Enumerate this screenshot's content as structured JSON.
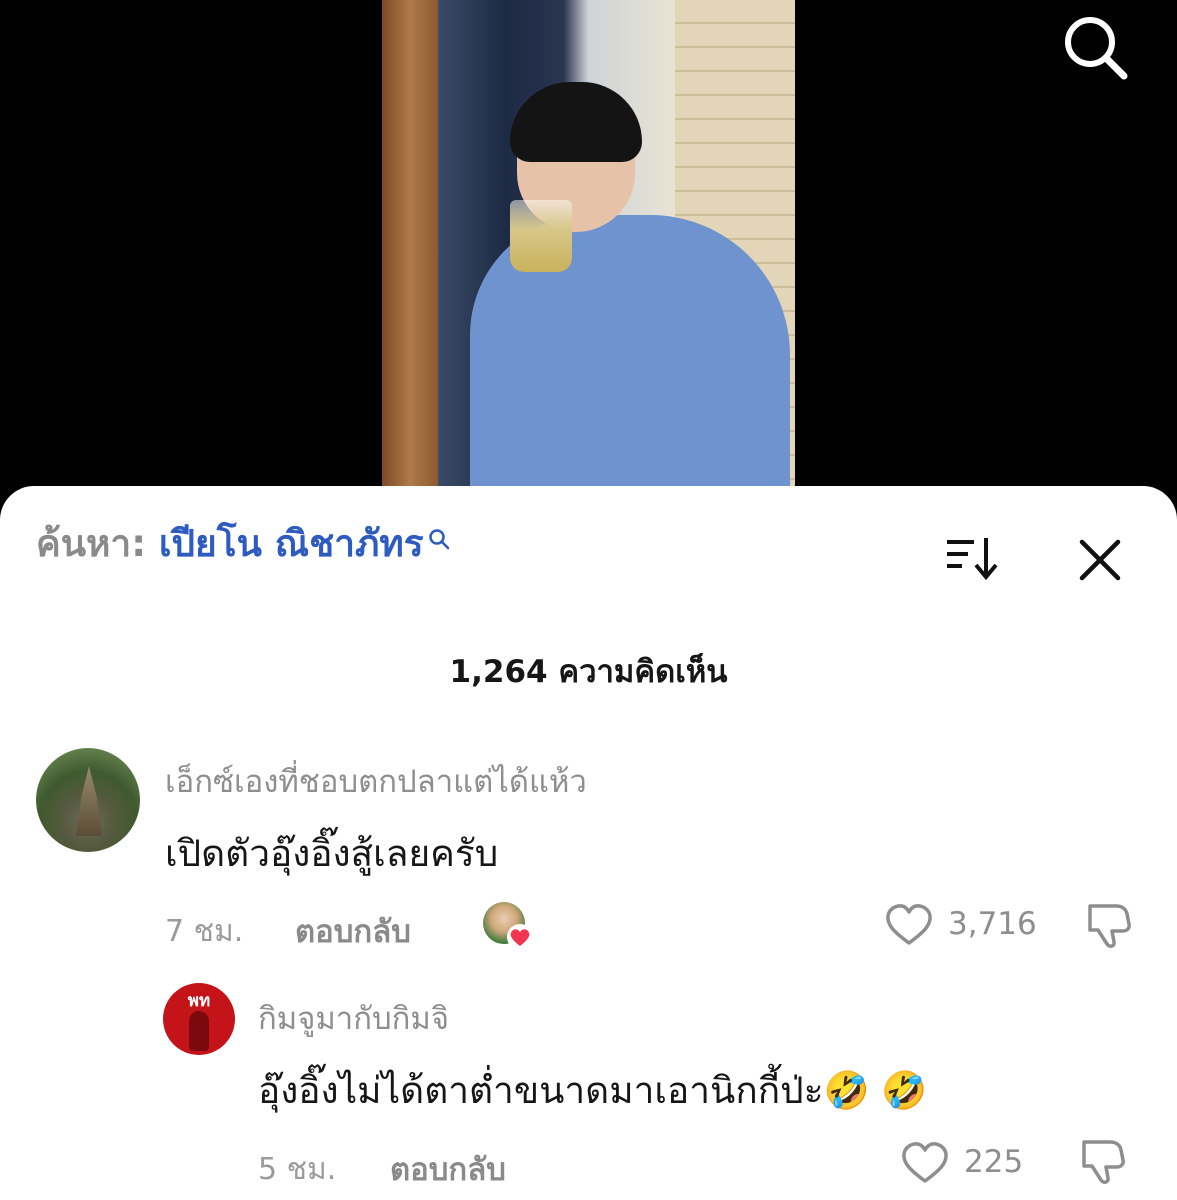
{
  "search": {
    "label": "ค้นหา:",
    "query": "เปียโน ณิชาภัทร"
  },
  "comment_count": "1,264 ความคิดเห็น",
  "comments": [
    {
      "username": "เอ็กซ์เองที่ชอบตกปลาแต่ได้แห้ว",
      "text": "เปิดตัวอุ๊งอิ๊งสู้เลยครับ",
      "time": "7 ชม.",
      "reply_label": "ตอบกลับ",
      "likes": "3,716",
      "creator_liked": true
    },
    {
      "username": "กิมจูมากับกิมจิ",
      "text": "อุ๊งอิ๊งไม่ได้ตาต่ำขนาดมาเอานิกกี้ป่ะ🤣 🤣",
      "time": "5 ชม.",
      "reply_label": "ตอบกลับ",
      "likes": "225",
      "avatar_text": "พท"
    }
  ],
  "colors": {
    "accent": "#2d5bbf",
    "heart": "#f0364f",
    "muted": "#8e8e8e"
  },
  "icons": [
    "search-icon",
    "sort-icon",
    "close-icon",
    "heart-outline-icon",
    "dislike-icon"
  ]
}
